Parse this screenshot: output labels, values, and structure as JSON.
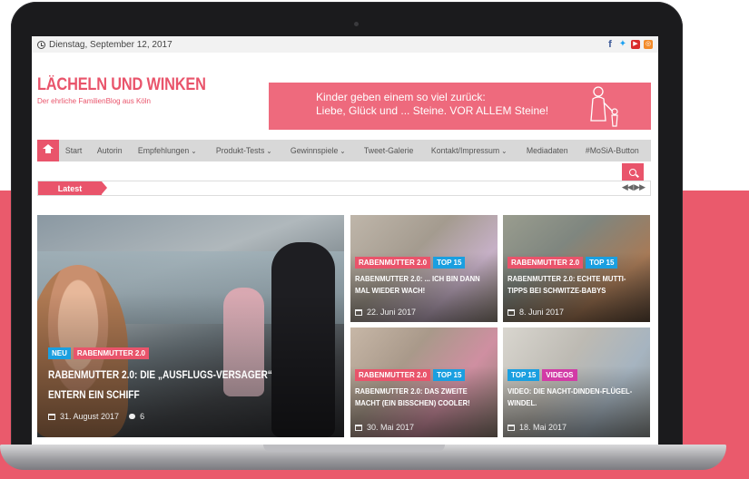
{
  "topbar": {
    "date": "Dienstag, September 12, 2017",
    "social_icons": [
      "facebook-icon",
      "twitter-icon",
      "youtube-icon",
      "instagram-icon"
    ]
  },
  "header": {
    "title": "LÄCHELN UND WINKEN",
    "tagline": "Der ehrliche FamilienBlog aus Köln",
    "banner_line1": "Kinder geben einem so viel zurück:",
    "banner_line2": "Liebe, Glück und ... Steine. VOR ALLEM Steine!"
  },
  "nav": {
    "items": [
      {
        "label": "Start"
      },
      {
        "label": "Autorin"
      },
      {
        "label": "Empfehlungen"
      },
      {
        "label": "Produkt-Tests"
      },
      {
        "label": "Gewinnspiele"
      },
      {
        "label": "Tweet-Galerie"
      },
      {
        "label": "Kontakt/Impressum"
      },
      {
        "label": "Mediadaten"
      },
      {
        "label": "#MoSiA-Button"
      }
    ]
  },
  "ticker": {
    "label": "Latest",
    "arrows": "◀◀ ▶▶"
  },
  "posts": {
    "main": {
      "tag1": "NEU",
      "tag2": "RABENMUTTER 2.0",
      "title_line1": "RABENMUTTER 2.0: DIE „AUSFLUGS-VERSAGER“",
      "title_line2": "ENTERN EIN SCHIFF",
      "date": "31. August 2017",
      "comments": "6"
    },
    "a": {
      "tag1": "RABENMUTTER 2.0",
      "tag2": "TOP 15",
      "title_line1": "RABENMUTTER 2.0: ... ICH BIN DANN",
      "title_line2": "MAL WIEDER WACH!",
      "date": "22. Juni 2017"
    },
    "b": {
      "tag1": "RABENMUTTER 2.0",
      "tag2": "TOP 15",
      "title_line1": "RABENMUTTER 2.0: ECHTE MUTTI-",
      "title_line2": "TIPPS BEI SCHWITZE-BABYS",
      "date": "8. Juni 2017"
    },
    "c": {
      "tag1": "RABENMUTTER 2.0",
      "tag2": "TOP 15",
      "title_line1": "RABENMUTTER 2.0: DAS ZWEITE",
      "title_line2": "MACHT (EIN BISSCHEN) COOLER!",
      "date": "30. Mai 2017"
    },
    "d": {
      "tag1": "TOP 15",
      "tag2": "VIDEOS",
      "title_line1": "VIDEO: DIE NACHT-DINDEN-FLÜGEL-",
      "title_line2": "WINDEL.",
      "date": "18. Mai 2017"
    }
  },
  "colors": {
    "accent": "#e9546b",
    "tag_blue": "#1a9fe0",
    "tag_magenta": "#d23ba6",
    "background_band": "#ea5a6c"
  }
}
